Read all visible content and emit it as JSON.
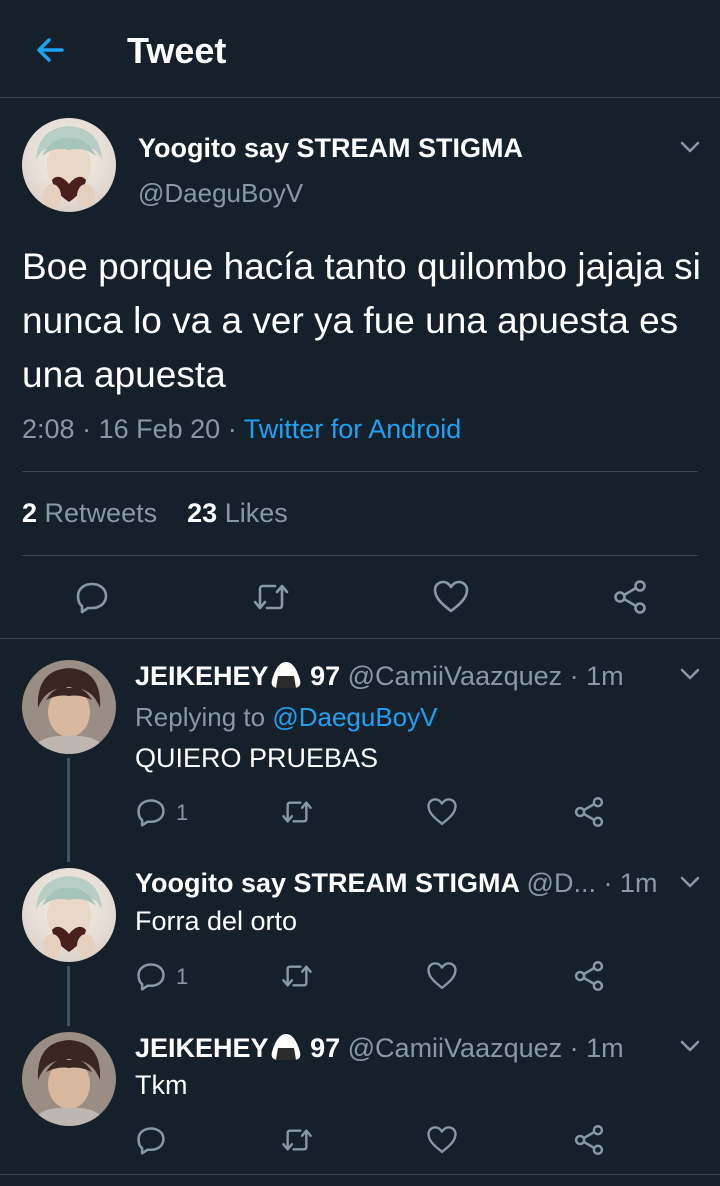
{
  "header": {
    "title": "Tweet"
  },
  "main_tweet": {
    "author_name": "Yoogito say STREAM STIGMA",
    "author_handle": "@DaeguBoyV",
    "text": "Boe porque hacía tanto quilombo jajaja si nunca lo va a ver ya fue una apuesta es una apuesta",
    "time": "2:08",
    "date": "16 Feb 20",
    "sep": "·",
    "source": "Twitter for Android",
    "retweets_count": "2",
    "retweets_label": "Retweets",
    "likes_count": "23",
    "likes_label": "Likes"
  },
  "replies": [
    {
      "name": "JEIKEHEY",
      "name_suffix": "97",
      "handle": "@CamiiVaazquez · 1m",
      "replying_prefix": "Replying to",
      "replying_to": "@DaeguBoyV",
      "text": "QUIERO PRUEBAS",
      "reply_count": "1"
    },
    {
      "name": "Yoogito say STREAM STIGMA",
      "handle": "@D... · 1m",
      "text": "Forra del orto",
      "reply_count": "1"
    },
    {
      "name": "JEIKEHEY",
      "name_suffix": "97",
      "handle": "@CamiiVaazquez · 1m",
      "text": "Tkm"
    }
  ],
  "colors": {
    "background": "#15202b",
    "accent": "#1da1f2",
    "muted": "#8899a6",
    "divider": "#38444d"
  },
  "icons": [
    "back-arrow-icon",
    "chevron-down-icon",
    "reply-icon",
    "retweet-icon",
    "like-icon",
    "share-icon",
    "rice-ball-emoji-icon"
  ]
}
